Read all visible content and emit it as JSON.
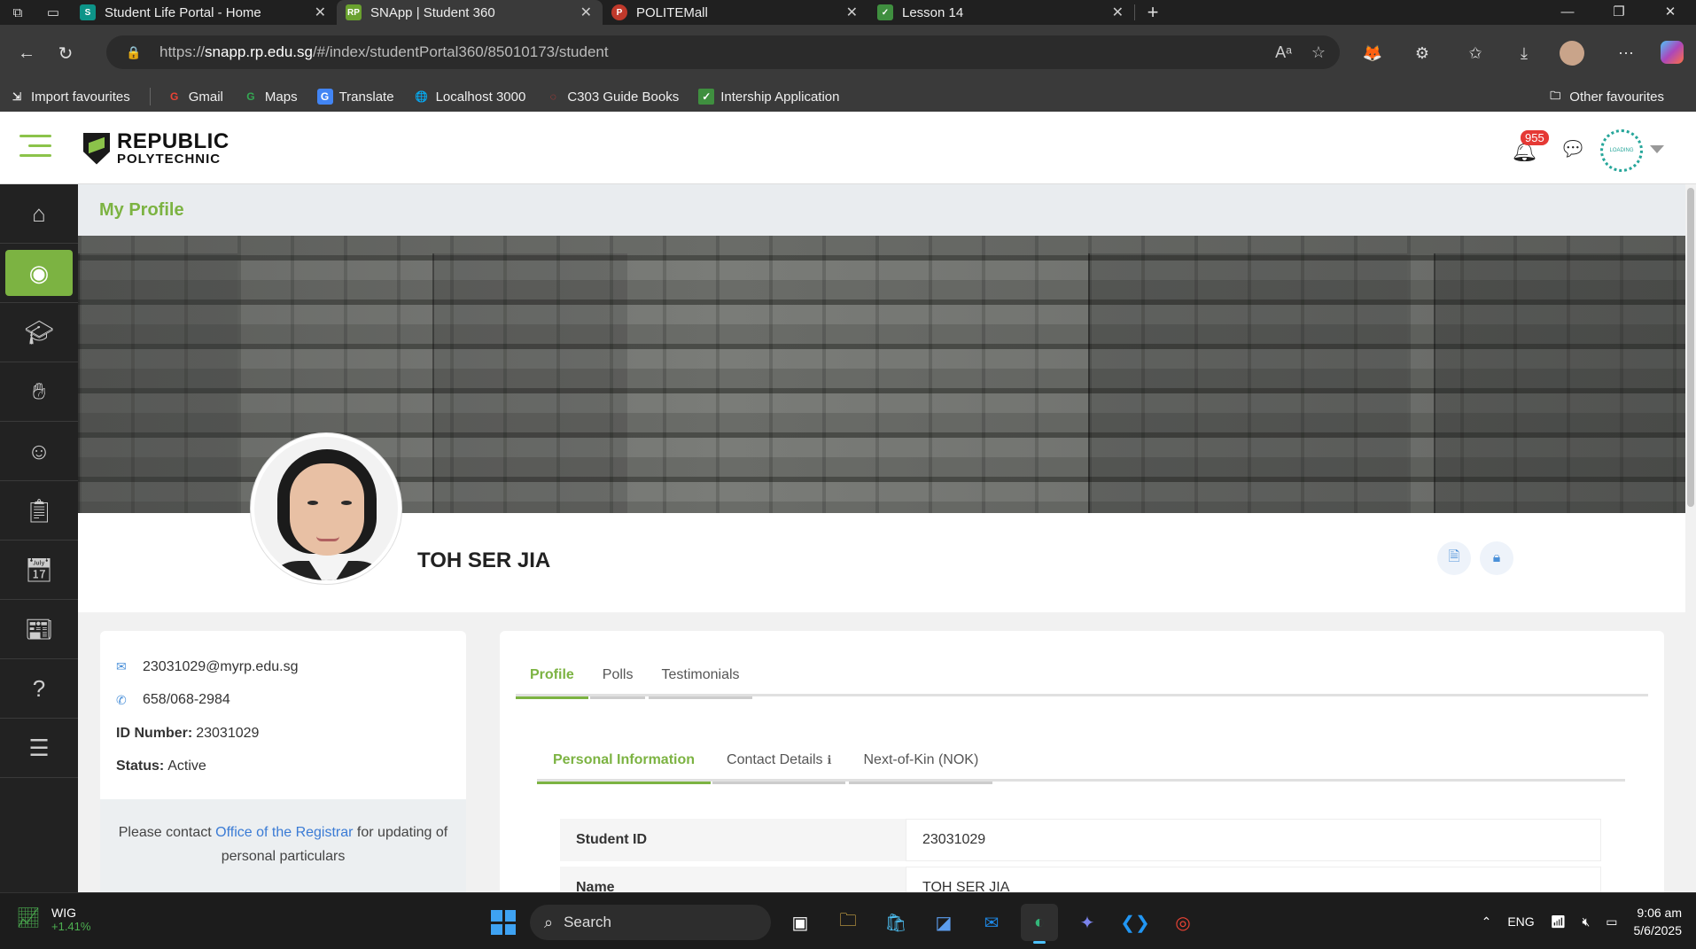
{
  "browser": {
    "tabs": [
      {
        "title": "Student Life Portal - Home",
        "favicon_color": "#0d9488",
        "favicon_text": "S"
      },
      {
        "title": "SNApp | Student 360",
        "favicon_color": "#6aa12f",
        "favicon_text": "RP"
      },
      {
        "title": "POLITEMall",
        "favicon_color": "#c0392b",
        "favicon_text": "P"
      },
      {
        "title": "Lesson 14",
        "favicon_color": "#3f8f3f",
        "favicon_text": "✓"
      }
    ],
    "url_prefix": "https://",
    "url_host": "snapp.rp.edu.sg",
    "url_path": "/#/index/studentPortal360/85010173/student",
    "bookmarks": [
      "Import favourites",
      "Gmail",
      "Maps",
      "Translate",
      "Localhost 3000",
      "C303 Guide Books",
      "Intership Application"
    ],
    "other_favourites": "Other favourites"
  },
  "header": {
    "logo_line1": "REPUBLIC",
    "logo_line2": "POLYTECHNIC",
    "notification_count": "955",
    "loading_text": "LOADING"
  },
  "page": {
    "title": "My Profile"
  },
  "profile": {
    "name": "TOH SER JIA",
    "email": "23031029@myrp.edu.sg",
    "phone": "658/068-2984",
    "id_label": "ID Number:",
    "id_number": "23031029",
    "status_label": "Status:",
    "status": "Active",
    "notice_pre": "Please contact ",
    "notice_link": "Office of the Registrar",
    "notice_post": " for updating of personal particulars"
  },
  "tabs": {
    "main": [
      "Profile",
      "Polls",
      "Testimonials"
    ],
    "sub": [
      "Personal Information",
      "Contact Details",
      "Next-of-Kin (NOK)"
    ]
  },
  "personal_info": [
    {
      "label": "Student ID",
      "value": "23031029"
    },
    {
      "label": "Name",
      "value": "TOH SER JIA"
    }
  ],
  "taskbar": {
    "ticker": "WIG",
    "ticker_change": "+1.41%",
    "search_placeholder": "Search",
    "language": "ENG",
    "time": "9:06 am",
    "date": "5/6/2025"
  },
  "colors": {
    "accent": "#7cb342",
    "link": "#3a7bd5",
    "badge": "#e53935"
  }
}
